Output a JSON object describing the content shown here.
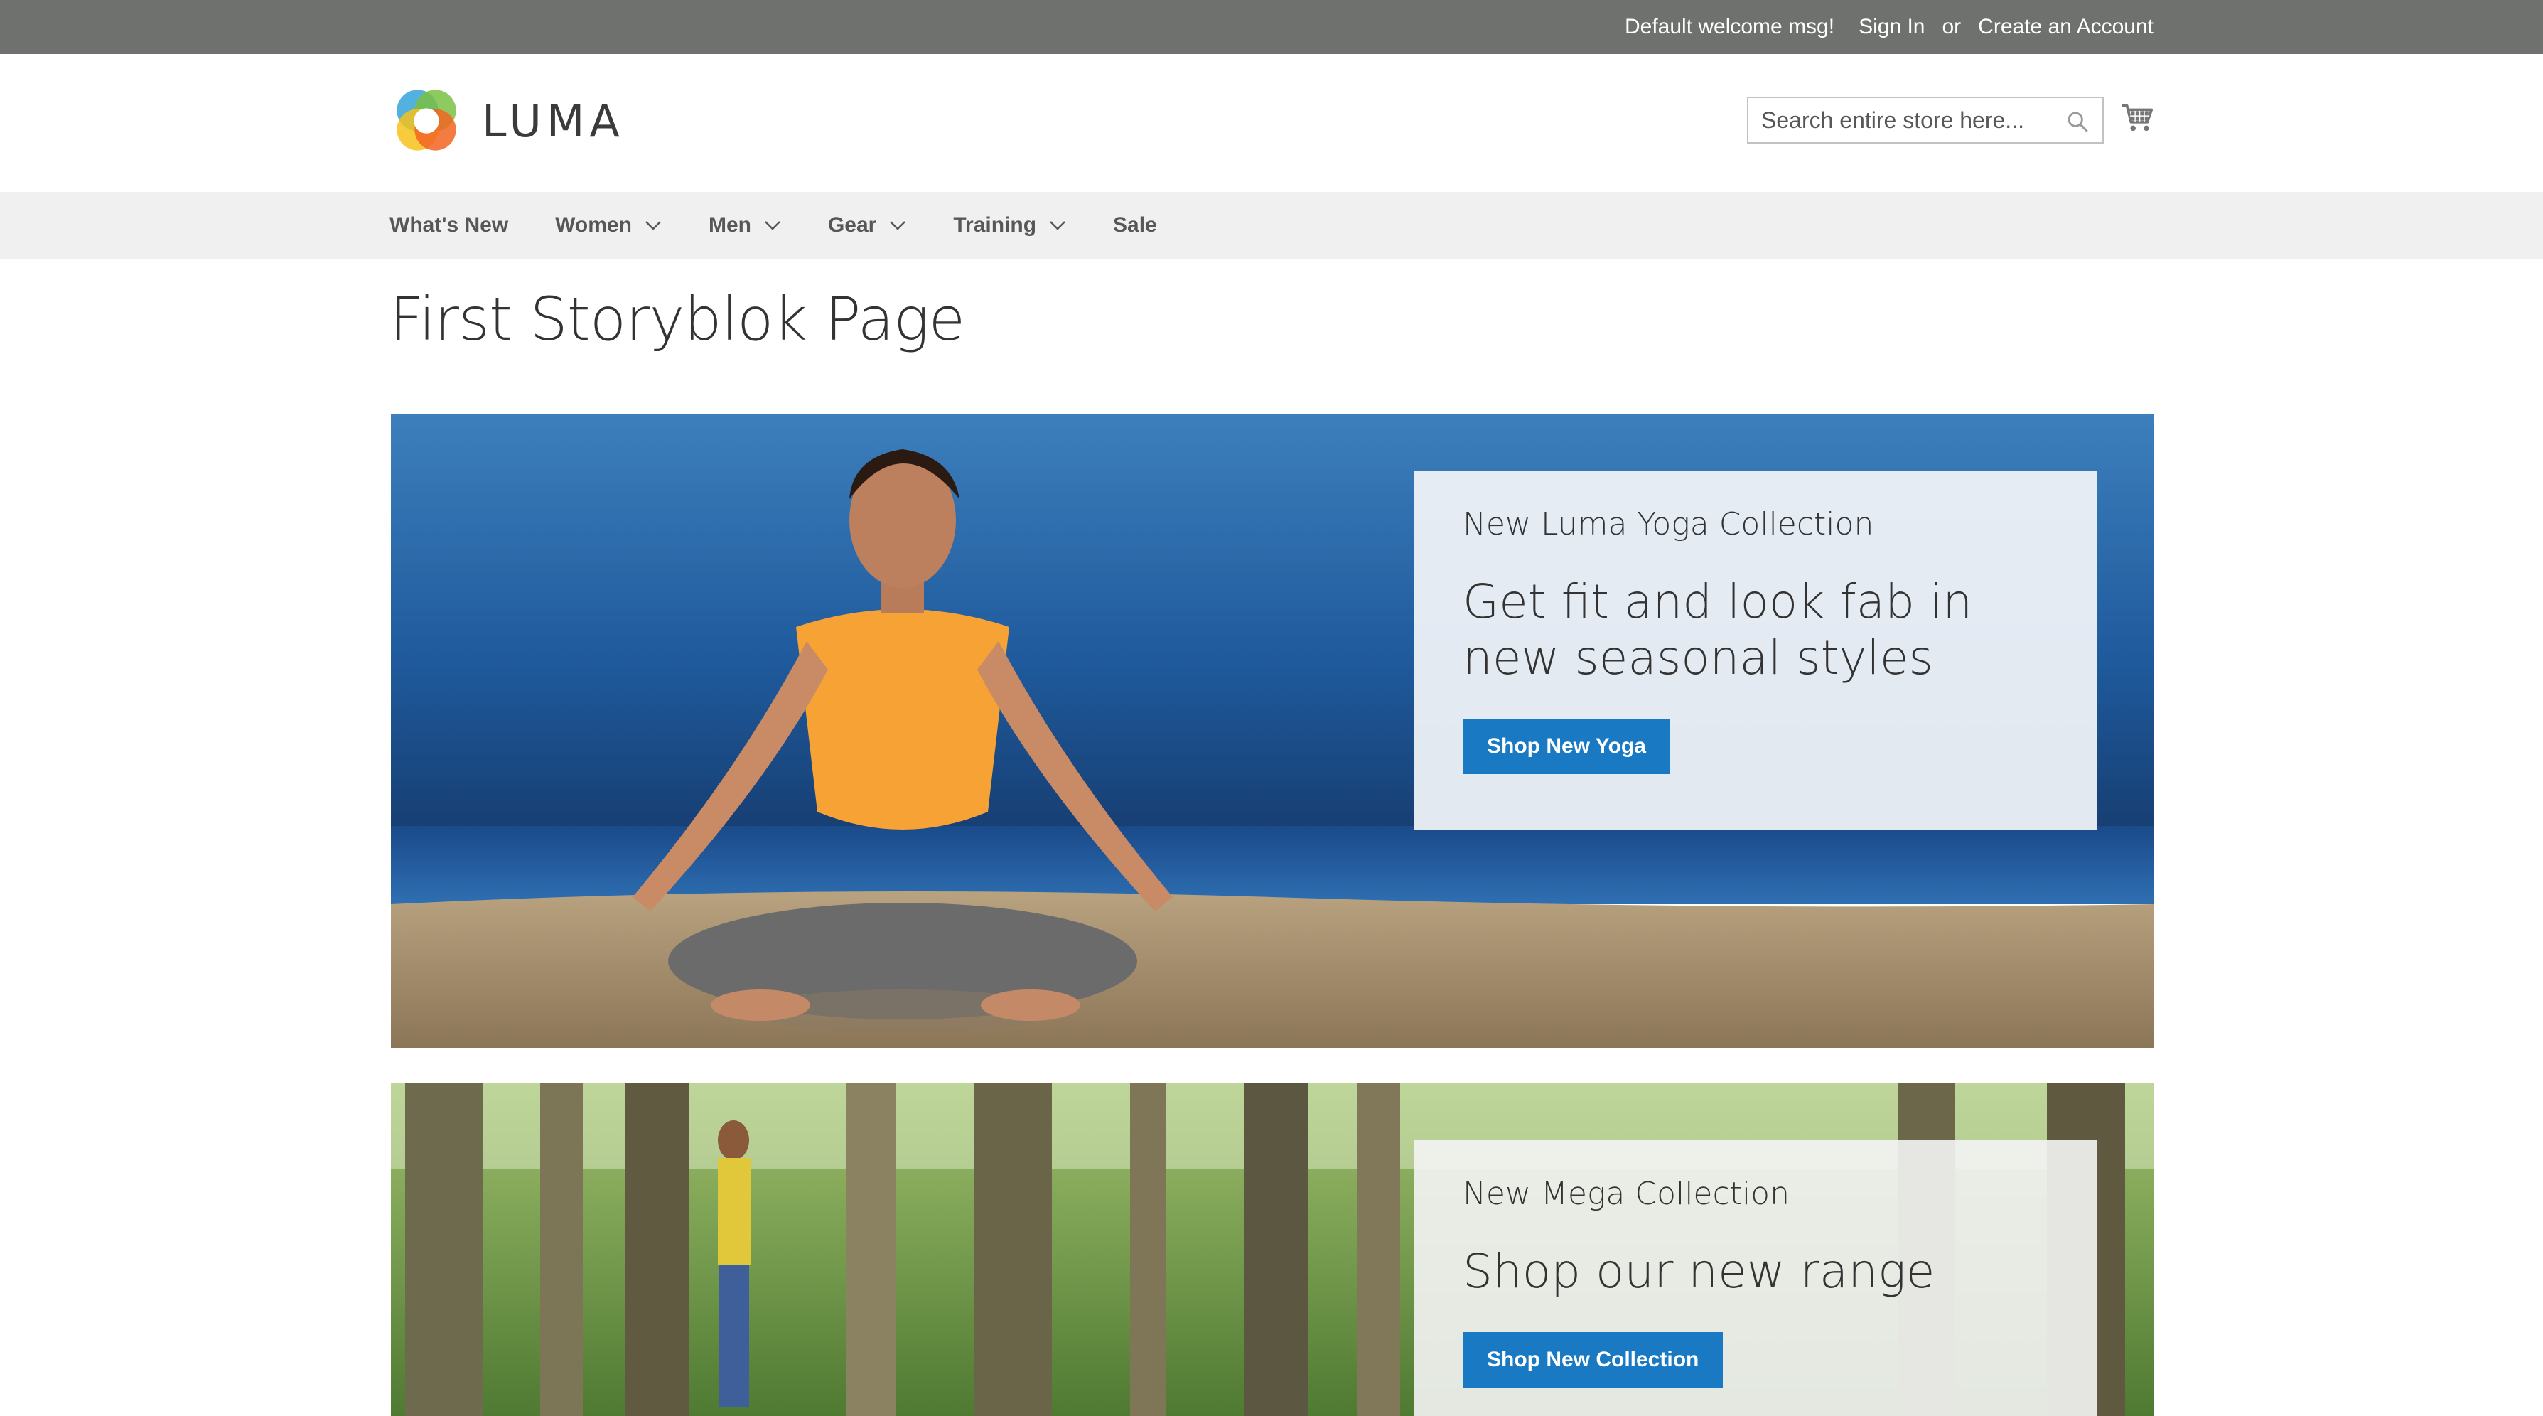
{
  "topbar": {
    "welcome": "Default welcome msg!",
    "sign_in": "Sign In",
    "or": "or",
    "create_account": "Create an Account"
  },
  "header": {
    "logo_text": "LUMA",
    "search_placeholder": "Search entire store here...",
    "search_icon": "search-icon",
    "cart_icon": "cart-icon"
  },
  "nav": {
    "items": [
      {
        "label": "What's New",
        "dropdown": false
      },
      {
        "label": "Women",
        "dropdown": true
      },
      {
        "label": "Men",
        "dropdown": true
      },
      {
        "label": "Gear",
        "dropdown": true
      },
      {
        "label": "Training",
        "dropdown": true
      },
      {
        "label": "Sale",
        "dropdown": false
      }
    ]
  },
  "page": {
    "title": "First Storyblok Page"
  },
  "banners": [
    {
      "subtitle": "New Luma Yoga Collection",
      "title": "Get fit and look fab in new seasonal styles",
      "button": "Shop New Yoga"
    },
    {
      "subtitle": "New Mega Collection",
      "title": "Shop our new range",
      "button": "Shop New Collection"
    }
  ],
  "colors": {
    "topbar_bg": "#6e716e",
    "nav_bg": "#f0f0f0",
    "button_primary": "#1979c3"
  }
}
